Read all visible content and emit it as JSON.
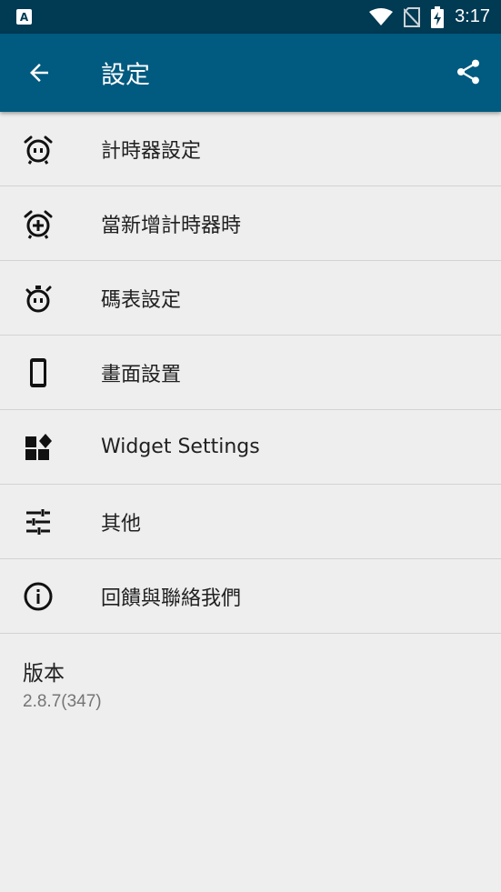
{
  "status_bar": {
    "time": "3:17",
    "app_badge": "A"
  },
  "toolbar": {
    "title": "設定",
    "back_icon": "arrow-back-icon",
    "share_icon": "share-icon"
  },
  "menu": [
    {
      "icon": "alarm-clock-icon",
      "label": "計時器設定"
    },
    {
      "icon": "alarm-add-icon",
      "label": "當新增計時器時"
    },
    {
      "icon": "stopwatch-icon",
      "label": "碼表設定"
    },
    {
      "icon": "phone-icon",
      "label": "畫面設置"
    },
    {
      "icon": "widgets-icon",
      "label": "Widget Settings"
    },
    {
      "icon": "tune-icon",
      "label": "其他"
    },
    {
      "icon": "info-icon",
      "label": "回饋與聯絡我們"
    }
  ],
  "version": {
    "title": "版本",
    "value": "2.8.7(347)"
  },
  "colors": {
    "status_bar": "#003a53",
    "toolbar": "#015a7f",
    "background": "#eeeeee"
  }
}
